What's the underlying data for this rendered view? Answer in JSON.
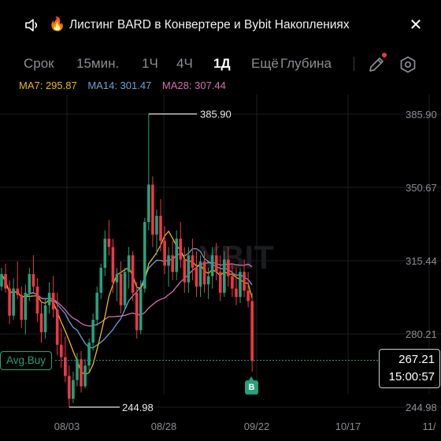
{
  "banner": {
    "fire_glyph": "🔥",
    "text": "Листинг BARD в Конвертере и Bybit Накоплениях",
    "close_glyph": "✕"
  },
  "timeframe_tabs": [
    {
      "label": "Срок",
      "active": false
    },
    {
      "label": "15мин.",
      "active": false
    },
    {
      "label": "1Ч",
      "active": false
    },
    {
      "label": "4Ч",
      "active": false
    },
    {
      "label": "1Д",
      "active": true
    },
    {
      "label": "Ещё",
      "active": false
    },
    {
      "label": "Глубина",
      "active": false
    }
  ],
  "indicators": [
    {
      "label": "MA7: 295.87",
      "color": "#f0b90b"
    },
    {
      "label": "MA14: 301.47",
      "color": "#6ba3d6"
    },
    {
      "label": "MA28: 307.44",
      "color": "#d66fb2"
    }
  ],
  "colors": {
    "up": "#26a17b",
    "down": "#f23645",
    "grid": "#1c1e22",
    "axis_text": "#8a8d93"
  },
  "watermark": "YBIT",
  "avg_buy_label": "Avg.Buy",
  "current_price": "267.21",
  "countdown": "15:00:57",
  "buy_marker": "B",
  "chart_data": {
    "type": "candlestick",
    "y_ticks": [
      "385.90",
      "350.67",
      "315.44",
      "280.21",
      "244.98"
    ],
    "ylim": [
      239,
      392
    ],
    "x_ticks": [
      "08/03",
      "08/28",
      "09/22",
      "10/17",
      "11/"
    ],
    "high_label": "385.90",
    "low_label": "244.98",
    "avg_buy_price": 267.5,
    "series_MA7_last": 295.87,
    "series_MA14_last": 301.47,
    "series_MA28_last": 307.44,
    "candles": [
      [
        303,
        312,
        301,
        309
      ],
      [
        309,
        314,
        300,
        302
      ],
      [
        302,
        306,
        285,
        289
      ],
      [
        289,
        307,
        287,
        302
      ],
      [
        302,
        315,
        297,
        299
      ],
      [
        299,
        303,
        283,
        287
      ],
      [
        287,
        304,
        280,
        300
      ],
      [
        300,
        312,
        296,
        309
      ],
      [
        309,
        318,
        300,
        303
      ],
      [
        303,
        307,
        286,
        290
      ],
      [
        290,
        296,
        276,
        281
      ],
      [
        281,
        297,
        278,
        294
      ],
      [
        294,
        305,
        290,
        300
      ],
      [
        300,
        308,
        288,
        292
      ],
      [
        292,
        300,
        270,
        275
      ],
      [
        275,
        283,
        264,
        269
      ],
      [
        269,
        279,
        257,
        260
      ],
      [
        260,
        265,
        244.98,
        249
      ],
      [
        249,
        262,
        247,
        258
      ],
      [
        258,
        271,
        255,
        268
      ],
      [
        268,
        272,
        252,
        255
      ],
      [
        255,
        268,
        254,
        265
      ],
      [
        265,
        278,
        262,
        276
      ],
      [
        276,
        290,
        272,
        287
      ],
      [
        287,
        303,
        284,
        300
      ],
      [
        300,
        314,
        297,
        312
      ],
      [
        312,
        330,
        308,
        326
      ],
      [
        326,
        335,
        318,
        322
      ],
      [
        322,
        326,
        300,
        305
      ],
      [
        305,
        312,
        296,
        309
      ],
      [
        309,
        315,
        290,
        294
      ],
      [
        294,
        312,
        292,
        310
      ],
      [
        310,
        322,
        302,
        318
      ],
      [
        318,
        320,
        296,
        300
      ],
      [
        300,
        305,
        278,
        282
      ],
      [
        282,
        306,
        280,
        302
      ],
      [
        302,
        336,
        300,
        334
      ],
      [
        334,
        386,
        330,
        352
      ],
      [
        352,
        356,
        322,
        328
      ],
      [
        328,
        340,
        318,
        337
      ],
      [
        337,
        345,
        320,
        325
      ],
      [
        325,
        332,
        309,
        313
      ],
      [
        313,
        322,
        303,
        318
      ],
      [
        318,
        325,
        306,
        310
      ],
      [
        310,
        330,
        306,
        326
      ],
      [
        326,
        334,
        312,
        316
      ],
      [
        316,
        322,
        300,
        305
      ],
      [
        305,
        322,
        300,
        318
      ],
      [
        318,
        326,
        306,
        312
      ],
      [
        312,
        320,
        298,
        303
      ],
      [
        303,
        318,
        298,
        315
      ],
      [
        315,
        320,
        300,
        304
      ],
      [
        304,
        312,
        297,
        308
      ],
      [
        308,
        322,
        302,
        318
      ],
      [
        318,
        324,
        306,
        310
      ],
      [
        310,
        318,
        296,
        300
      ],
      [
        300,
        320,
        298,
        316
      ],
      [
        316,
        322,
        303,
        308
      ],
      [
        308,
        314,
        298,
        302
      ],
      [
        302,
        312,
        294,
        298
      ],
      [
        298,
        312,
        295,
        310
      ],
      [
        310,
        316,
        298,
        301
      ],
      [
        301,
        310,
        293,
        296
      ],
      [
        296,
        300,
        262,
        267.21
      ]
    ]
  }
}
